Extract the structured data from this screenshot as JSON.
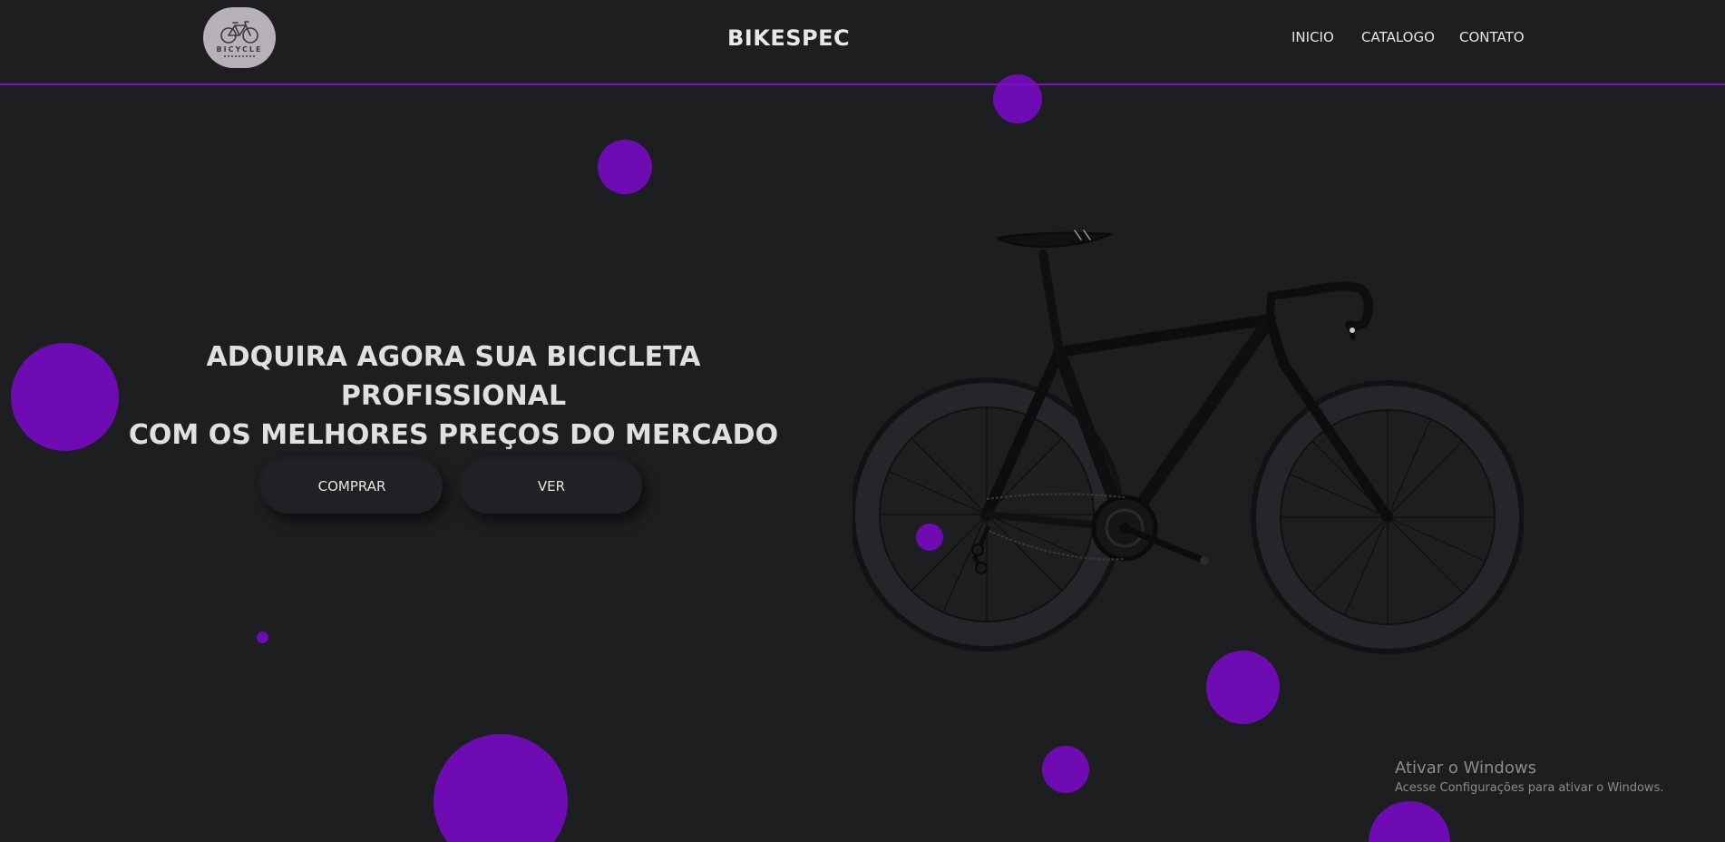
{
  "header": {
    "logo_text": "BICYCLE",
    "brand": "BIKESPEC",
    "nav": {
      "inicio": "INICIO",
      "catalogo": "CATALOGO",
      "contato": "CONTATO"
    }
  },
  "hero": {
    "headline_line1": "ADQUIRA AGORA SUA BICICLETA PROFISSIONAL",
    "headline_line2": "COM OS MELHORES PREÇOS DO MERCADO",
    "buttons": {
      "comprar": "COMPRAR",
      "ver": "VER"
    }
  },
  "watermark": {
    "title": "Ativar o Windows",
    "subtitle": "Acesse Configurações para ativar o Windows."
  },
  "colors": {
    "background": "#1d1e20",
    "accent": "#6e0bb3",
    "divider": "#7a10c2",
    "button": "#202124"
  },
  "icons": {
    "logo": "bicycle-icon",
    "hero_image": "road-bike-image"
  }
}
